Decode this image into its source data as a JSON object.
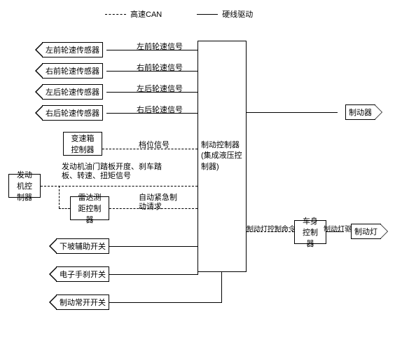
{
  "legend": {
    "can": "高速CAN",
    "hard": "硬线驱动"
  },
  "sensors": {
    "lf": "左前轮速传感器",
    "rf": "右前轮速传感器",
    "lr": "左后轮速传感器",
    "rr": "右后轮速传感器"
  },
  "signals": {
    "lf": "左前轮速信号",
    "rf": "右前轮速信号",
    "lr": "左后轮速信号",
    "rr": "右后轮速信号",
    "gear": "档位信号",
    "engine": "发动机油门踏板开度、刹车踏板、转速、扭矩信号",
    "aeb": "自动紧急制动请求",
    "brakelight": "制动灯控制命令",
    "brakelight_drive": "制动灯驱动"
  },
  "boxes": {
    "tcu": "变速箱控制器",
    "ecu": "发动机控制器",
    "radar": "雷达测距控制器",
    "main_l1": "制动控制器",
    "main_l2": "(集成液压控制器)",
    "bcm": "车身控制器"
  },
  "switches": {
    "downhill": "下坡辅助开关",
    "epb": "电子手刹开关",
    "brake_no": "制动常开开关"
  },
  "outputs": {
    "brake": "制动器",
    "brakelight": "制动灯"
  }
}
